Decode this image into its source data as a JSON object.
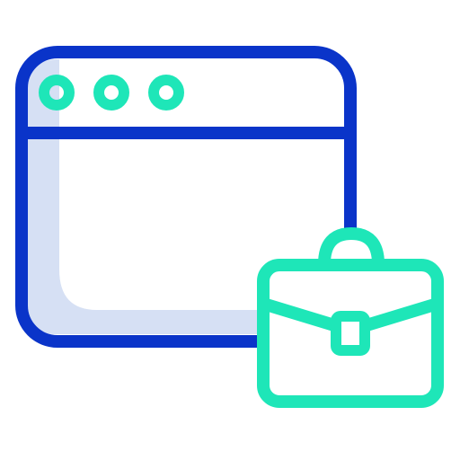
{
  "icon": {
    "name": "browser-window-with-briefcase-icon",
    "colors": {
      "window_outline": "#0a34c9",
      "window_shadow": "#d6e0f4",
      "accent": "#1ee6b8",
      "background": "#ffffff"
    },
    "parts": [
      "browser-window-icon",
      "window-dot-icon",
      "briefcase-icon"
    ]
  }
}
